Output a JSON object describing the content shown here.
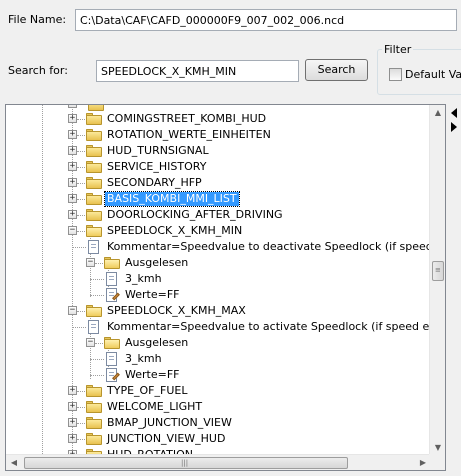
{
  "file": {
    "label": "File Name:",
    "value": "C:\\Data\\CAF\\CAFD_000000F9_007_002_006.ncd"
  },
  "search": {
    "label": "Search for:",
    "value": "SPEEDLOCK_X_KMH_MIN",
    "button": "Search"
  },
  "filter": {
    "title": "Filter",
    "default_values_label": "Default Valu"
  },
  "tree": {
    "nodes": [
      {
        "text": "COMINGSTREET_KOMBI_HUD"
      },
      {
        "text": "ROTATION_WERTE_EINHEITEN"
      },
      {
        "text": "HUD_TURNSIGNAL"
      },
      {
        "text": "SERVICE_HISTORY"
      },
      {
        "text": "SECONDARY_HFP"
      },
      {
        "text": "BASIS_KOMBI_MMI_LIST"
      },
      {
        "text": "DOORLOCKING_AFTER_DRIVING"
      },
      {
        "text": "SPEEDLOCK_X_KMH_MIN"
      },
      {
        "text": "Kommentar=Speedvalue to deactivate Speedlock (if speed falls b"
      },
      {
        "text": "Ausgelesen"
      },
      {
        "text": "3_kmh"
      },
      {
        "text": "Werte=FF"
      },
      {
        "text": "SPEEDLOCK_X_KMH_MAX"
      },
      {
        "text": "Kommentar=Speedvalue to activate Speedlock (if speed exceeds"
      },
      {
        "text": "Ausgelesen"
      },
      {
        "text": "3_kmh"
      },
      {
        "text": "Werte=FF"
      },
      {
        "text": "TYPE_OF_FUEL"
      },
      {
        "text": "WELCOME_LIGHT"
      },
      {
        "text": "BMAP_JUNCTION_VIEW"
      },
      {
        "text": "JUNCTION_VIEW_HUD"
      },
      {
        "text": "HUD_ROTATION"
      }
    ]
  }
}
